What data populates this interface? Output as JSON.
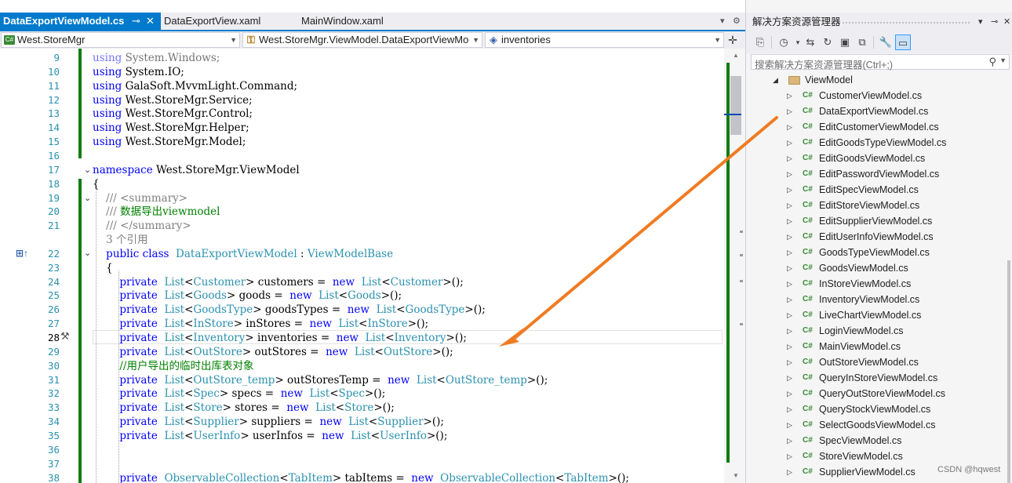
{
  "tabs": [
    {
      "label": "DataExportViewModel.cs",
      "active": true
    },
    {
      "label": "DataExportView.xaml",
      "active": false
    },
    {
      "label": "MainWindow.xaml",
      "active": false
    }
  ],
  "tab_pin_glyph": "⊸",
  "tab_close_glyph": "✕",
  "navbar": {
    "project": "West.StoreMgr",
    "type": "West.StoreMgr.ViewModel.DataExportViewMo",
    "member": "inventories"
  },
  "code_lines": [
    {
      "n": "9",
      "tokens": [
        [
          "kw",
          "using"
        ],
        [
          "",
          "System.Windows;"
        ]
      ],
      "fade": true
    },
    {
      "n": "10",
      "tokens": [
        [
          "kw",
          "using"
        ],
        [
          "",
          "System.IO;"
        ]
      ]
    },
    {
      "n": "11",
      "tokens": [
        [
          "kw",
          "using"
        ],
        [
          "",
          "GalaSoft.MvvmLight.Command;"
        ]
      ]
    },
    {
      "n": "12",
      "tokens": [
        [
          "kw",
          "using"
        ],
        [
          "",
          "West.StoreMgr.Service;"
        ]
      ]
    },
    {
      "n": "13",
      "tokens": [
        [
          "kw",
          "using"
        ],
        [
          "",
          "West.StoreMgr.Control;"
        ]
      ]
    },
    {
      "n": "14",
      "tokens": [
        [
          "kw",
          "using"
        ],
        [
          "",
          "West.StoreMgr.Helper;"
        ]
      ]
    },
    {
      "n": "15",
      "tokens": [
        [
          "kw",
          "using"
        ],
        [
          "",
          "West.StoreMgr.Model;"
        ]
      ]
    },
    {
      "n": "16",
      "tokens": []
    },
    {
      "n": "17",
      "tokens": [
        [
          "kw",
          "namespace"
        ],
        [
          "",
          "West.StoreMgr.ViewModel"
        ]
      ]
    },
    {
      "n": "18",
      "tokens": [
        [
          "",
          "{"
        ]
      ]
    },
    {
      "n": "19",
      "tokens": [
        [
          "",
          "    "
        ],
        [
          "cmg",
          "/// <summary>"
        ]
      ]
    },
    {
      "n": "20",
      "tokens": [
        [
          "",
          "    "
        ],
        [
          "cmg",
          "/// "
        ],
        [
          "cm",
          "数据导出viewmodel"
        ]
      ]
    },
    {
      "n": "21",
      "tokens": [
        [
          "",
          "    "
        ],
        [
          "cmg",
          "/// </summary>"
        ]
      ]
    },
    {
      "n": "",
      "tokens": [
        [
          "",
          "    "
        ],
        [
          "ref",
          "3 个引用"
        ]
      ]
    },
    {
      "n": "22",
      "tokens": [
        [
          "",
          "    "
        ],
        [
          "kw",
          "public class"
        ],
        [
          "",
          ""
        ],
        [
          "ty",
          "DataExportViewModel"
        ],
        [
          "",
          " : "
        ],
        [
          "ty",
          "ViewModelBase"
        ]
      ]
    },
    {
      "n": "23",
      "tokens": [
        [
          "",
          "    {"
        ]
      ]
    },
    {
      "n": "24",
      "tokens": [
        [
          "",
          "        "
        ],
        [
          "kw",
          "private"
        ],
        [
          "",
          ""
        ],
        [
          "ty",
          "List"
        ],
        [
          "",
          "<"
        ],
        [
          "ty",
          "Customer"
        ],
        [
          "",
          "> customers = "
        ],
        [
          "kw",
          "new"
        ],
        [
          "",
          ""
        ],
        [
          "ty",
          "List"
        ],
        [
          "",
          "<"
        ],
        [
          "ty",
          "Customer"
        ],
        [
          "",
          ">();"
        ]
      ]
    },
    {
      "n": "25",
      "tokens": [
        [
          "",
          "        "
        ],
        [
          "kw",
          "private"
        ],
        [
          "",
          ""
        ],
        [
          "ty",
          "List"
        ],
        [
          "",
          "<"
        ],
        [
          "ty",
          "Goods"
        ],
        [
          "",
          "> goods = "
        ],
        [
          "kw",
          "new"
        ],
        [
          "",
          ""
        ],
        [
          "ty",
          "List"
        ],
        [
          "",
          "<"
        ],
        [
          "ty",
          "Goods"
        ],
        [
          "",
          ">();"
        ]
      ]
    },
    {
      "n": "26",
      "tokens": [
        [
          "",
          "        "
        ],
        [
          "kw",
          "private"
        ],
        [
          "",
          ""
        ],
        [
          "ty",
          "List"
        ],
        [
          "",
          "<"
        ],
        [
          "ty",
          "GoodsType"
        ],
        [
          "",
          "> goodsTypes = "
        ],
        [
          "kw",
          "new"
        ],
        [
          "",
          ""
        ],
        [
          "ty",
          "List"
        ],
        [
          "",
          "<"
        ],
        [
          "ty",
          "GoodsType"
        ],
        [
          "",
          ">();"
        ]
      ]
    },
    {
      "n": "27",
      "tokens": [
        [
          "",
          "        "
        ],
        [
          "kw",
          "private"
        ],
        [
          "",
          ""
        ],
        [
          "ty",
          "List"
        ],
        [
          "",
          "<"
        ],
        [
          "ty",
          "InStore"
        ],
        [
          "",
          "> inStores = "
        ],
        [
          "kw",
          "new"
        ],
        [
          "",
          ""
        ],
        [
          "ty",
          "List"
        ],
        [
          "",
          "<"
        ],
        [
          "ty",
          "InStore"
        ],
        [
          "",
          ">();"
        ]
      ]
    },
    {
      "n": "28",
      "tokens": [
        [
          "",
          "        "
        ],
        [
          "kw",
          "private"
        ],
        [
          "",
          ""
        ],
        [
          "ty",
          "List"
        ],
        [
          "",
          "<"
        ],
        [
          "ty",
          "Inventory"
        ],
        [
          "",
          "> inventories = "
        ],
        [
          "kw",
          "new"
        ],
        [
          "",
          ""
        ],
        [
          "ty",
          "List"
        ],
        [
          "",
          "<"
        ],
        [
          "ty",
          "Inventory"
        ],
        [
          "",
          ">();"
        ]
      ],
      "current": true
    },
    {
      "n": "29",
      "tokens": [
        [
          "",
          "        "
        ],
        [
          "kw",
          "private"
        ],
        [
          "",
          ""
        ],
        [
          "ty",
          "List"
        ],
        [
          "",
          "<"
        ],
        [
          "ty",
          "OutStore"
        ],
        [
          "",
          "> outStores = "
        ],
        [
          "kw",
          "new"
        ],
        [
          "",
          ""
        ],
        [
          "ty",
          "List"
        ],
        [
          "",
          "<"
        ],
        [
          "ty",
          "OutStore"
        ],
        [
          "",
          ">();"
        ]
      ]
    },
    {
      "n": "30",
      "tokens": [
        [
          "",
          "        "
        ],
        [
          "cm",
          "//用户导出的临时出库表对象"
        ]
      ]
    },
    {
      "n": "31",
      "tokens": [
        [
          "",
          "        "
        ],
        [
          "kw",
          "private"
        ],
        [
          "",
          ""
        ],
        [
          "ty",
          "List"
        ],
        [
          "",
          "<"
        ],
        [
          "ty",
          "OutStore_temp"
        ],
        [
          "",
          "> outStoresTemp = "
        ],
        [
          "kw",
          "new"
        ],
        [
          "",
          ""
        ],
        [
          "ty",
          "List"
        ],
        [
          "",
          "<"
        ],
        [
          "ty",
          "OutStore_temp"
        ],
        [
          "",
          ">();"
        ]
      ]
    },
    {
      "n": "32",
      "tokens": [
        [
          "",
          "        "
        ],
        [
          "kw",
          "private"
        ],
        [
          "",
          ""
        ],
        [
          "ty",
          "List"
        ],
        [
          "",
          "<"
        ],
        [
          "ty",
          "Spec"
        ],
        [
          "",
          "> specs = "
        ],
        [
          "kw",
          "new"
        ],
        [
          "",
          ""
        ],
        [
          "ty",
          "List"
        ],
        [
          "",
          "<"
        ],
        [
          "ty",
          "Spec"
        ],
        [
          "",
          ">();"
        ]
      ]
    },
    {
      "n": "33",
      "tokens": [
        [
          "",
          "        "
        ],
        [
          "kw",
          "private"
        ],
        [
          "",
          ""
        ],
        [
          "ty",
          "List"
        ],
        [
          "",
          "<"
        ],
        [
          "ty",
          "Store"
        ],
        [
          "",
          "> stores = "
        ],
        [
          "kw",
          "new"
        ],
        [
          "",
          ""
        ],
        [
          "ty",
          "List"
        ],
        [
          "",
          "<"
        ],
        [
          "ty",
          "Store"
        ],
        [
          "",
          ">();"
        ]
      ]
    },
    {
      "n": "34",
      "tokens": [
        [
          "",
          "        "
        ],
        [
          "kw",
          "private"
        ],
        [
          "",
          ""
        ],
        [
          "ty",
          "List"
        ],
        [
          "",
          "<"
        ],
        [
          "ty",
          "Supplier"
        ],
        [
          "",
          "> suppliers = "
        ],
        [
          "kw",
          "new"
        ],
        [
          "",
          ""
        ],
        [
          "ty",
          "List"
        ],
        [
          "",
          "<"
        ],
        [
          "ty",
          "Supplier"
        ],
        [
          "",
          ">();"
        ]
      ]
    },
    {
      "n": "35",
      "tokens": [
        [
          "",
          "        "
        ],
        [
          "kw",
          "private"
        ],
        [
          "",
          ""
        ],
        [
          "ty",
          "List"
        ],
        [
          "",
          "<"
        ],
        [
          "ty",
          "UserInfo"
        ],
        [
          "",
          "> userInfos = "
        ],
        [
          "kw",
          "new"
        ],
        [
          "",
          ""
        ],
        [
          "ty",
          "List"
        ],
        [
          "",
          "<"
        ],
        [
          "ty",
          "UserInfo"
        ],
        [
          "",
          ">();"
        ]
      ]
    },
    {
      "n": "36",
      "tokens": []
    },
    {
      "n": "37",
      "tokens": []
    },
    {
      "n": "38",
      "tokens": [
        [
          "",
          "        "
        ],
        [
          "kw",
          "private"
        ],
        [
          "",
          ""
        ],
        [
          "ty",
          "ObservableCollection"
        ],
        [
          "",
          "<"
        ],
        [
          "ty",
          "TabItem"
        ],
        [
          "",
          "> tabItems = "
        ],
        [
          "kw",
          "new"
        ],
        [
          "",
          ""
        ],
        [
          "ty",
          "ObservableCollection"
        ],
        [
          "",
          "<"
        ],
        [
          "ty",
          "TabItem"
        ],
        [
          "",
          ">();"
        ]
      ]
    }
  ],
  "solution_explorer": {
    "title": "解决方案资源管理器",
    "search_placeholder": "搜索解决方案资源管理器(Ctrl+;)",
    "folder": "ViewModel",
    "files": [
      "CustomerViewModel.cs",
      "DataExportViewModel.cs",
      "EditCustomerViewModel.cs",
      "EditGoodsTypeViewModel.cs",
      "EditGoodsViewModel.cs",
      "EditPasswordViewModel.cs",
      "EditSpecViewModel.cs",
      "EditStoreViewModel.cs",
      "EditSupplierViewModel.cs",
      "EditUserInfoViewModel.cs",
      "GoodsTypeViewModel.cs",
      "GoodsViewModel.cs",
      "InStoreViewModel.cs",
      "InventoryViewModel.cs",
      "LiveChartViewModel.cs",
      "LoginViewModel.cs",
      "MainViewModel.cs",
      "OutStoreViewModel.cs",
      "QueryInStoreViewModel.cs",
      "QueryOutStoreViewModel.cs",
      "QueryStockViewModel.cs",
      "SelectGoodsViewModel.cs",
      "SpecViewModel.cs",
      "StoreViewModel.cs",
      "SupplierViewModel.cs"
    ],
    "file_badge": "C#"
  },
  "watermark": "CSDN @hqwest",
  "colors": {
    "accent": "#007acc",
    "change_bar": "#107c10",
    "keyword": "#0000ff",
    "type": "#2b91af",
    "comment": "#008000",
    "arrow": "#f07b22"
  }
}
